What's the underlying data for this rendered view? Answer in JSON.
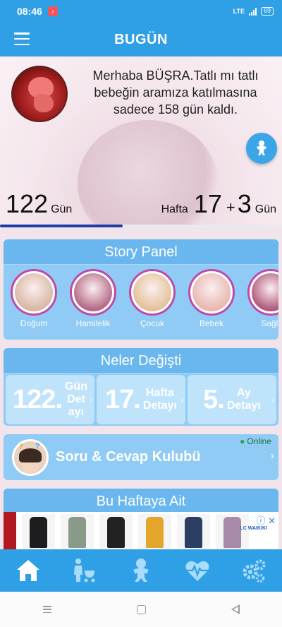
{
  "status_bar": {
    "time": "08:46",
    "notification_icon": "music-note-icon",
    "network": "LTE",
    "battery": "69"
  },
  "app_bar": {
    "title": "BUGÜN",
    "menu_icon": "hamburger-menu-icon"
  },
  "hero": {
    "greeting": "Merhaba BÜŞRA.Tatlı mı tatlı bebeğin aramıza katılmasına sadece 158 gün kaldı.",
    "days_count": "122",
    "days_unit": "Gün",
    "week_label": "Hafta",
    "weeks": "17",
    "plus": "+",
    "extra_days": "3",
    "extra_days_unit": "Gün",
    "progress_fraction": 0.435,
    "accent_color": "#1e3ea8"
  },
  "story_panel": {
    "title": "Story Panel",
    "items": [
      {
        "label": "Doğum",
        "color": "#d9b8a4"
      },
      {
        "label": "Hamilelik",
        "color": "#b56a88"
      },
      {
        "label": "Çocuk",
        "color": "#e3c29a"
      },
      {
        "label": "Bebek",
        "color": "#e8b7b0"
      },
      {
        "label": "Sağlı",
        "color": "#b05a7c"
      }
    ]
  },
  "neler_degisti": {
    "title": "Neler Değişti",
    "tiles": [
      {
        "number": "122.",
        "line1": "Gün",
        "line2": "Det",
        "line3": "ayı"
      },
      {
        "number": "17.",
        "line1": "Hafta",
        "line2": "Detayı",
        "line3": ""
      },
      {
        "number": "5.",
        "line1": "Ay",
        "line2": "Detayı",
        "line3": ""
      }
    ]
  },
  "forum": {
    "label": "Soru & Cevap Kulubü",
    "status": "Online",
    "status_color": "#21a83a",
    "bubble_q": "?"
  },
  "this_week": {
    "title": "Bu Haftaya Ait",
    "ad_logo": "LC WAIKIKI",
    "ad_products": [
      "#1d1d1f",
      "#8a9a88",
      "#222222",
      "#e3a52a",
      "#2c3e62",
      "#a88aa8"
    ]
  },
  "bottom_nav": {
    "tabs": [
      "home-icon",
      "mother-stroller-icon",
      "baby-icon",
      "heart-pulse-icon",
      "settings-gears-icon"
    ],
    "active_color": "#ffffff",
    "inactive_color": "#a9dbfa"
  }
}
